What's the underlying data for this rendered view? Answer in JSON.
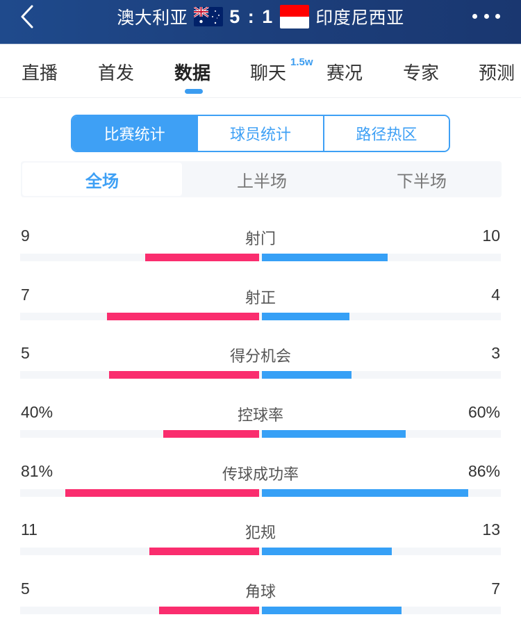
{
  "header": {
    "home_team": "澳大利亚",
    "away_team": "印度尼西亚",
    "score": "5 : 1",
    "home_flag": "australia-flag",
    "away_flag": "indonesia-flag",
    "back_icon": "chevron-left-icon",
    "more_icon": "more-dots-icon"
  },
  "tabs": [
    {
      "label": "直播"
    },
    {
      "label": "首发"
    },
    {
      "label": "数据",
      "active": true
    },
    {
      "label": "聊天",
      "badge": "1.5w"
    },
    {
      "label": "赛况"
    },
    {
      "label": "专家"
    },
    {
      "label": "预测"
    }
  ],
  "segments": [
    {
      "label": "比赛统计",
      "active": true
    },
    {
      "label": "球员统计"
    },
    {
      "label": "路径热区"
    }
  ],
  "periods": [
    {
      "label": "全场",
      "active": true
    },
    {
      "label": "上半场"
    },
    {
      "label": "下半场"
    }
  ],
  "colors": {
    "home": "#fa2d6e",
    "away": "#36a0f6",
    "accent": "#3ea0f5",
    "header_bg": "#1c3f7c"
  },
  "stats": [
    {
      "label": "射门",
      "home": "9",
      "away": "10",
      "home_share": 0.474,
      "away_share": 0.526
    },
    {
      "label": "射正",
      "home": "7",
      "away": "4",
      "home_share": 0.636,
      "away_share": 0.364
    },
    {
      "label": "得分机会",
      "home": "5",
      "away": "3",
      "home_share": 0.625,
      "away_share": 0.375
    },
    {
      "label": "控球率",
      "home": "40%",
      "away": "60%",
      "home_share": 0.4,
      "away_share": 0.6
    },
    {
      "label": "传球成功率",
      "home": "81%",
      "away": "86%",
      "home_share": 0.81,
      "away_share": 0.86
    },
    {
      "label": "犯规",
      "home": "11",
      "away": "13",
      "home_share": 0.458,
      "away_share": 0.542
    },
    {
      "label": "角球",
      "home": "5",
      "away": "7",
      "home_share": 0.417,
      "away_share": 0.583
    }
  ]
}
